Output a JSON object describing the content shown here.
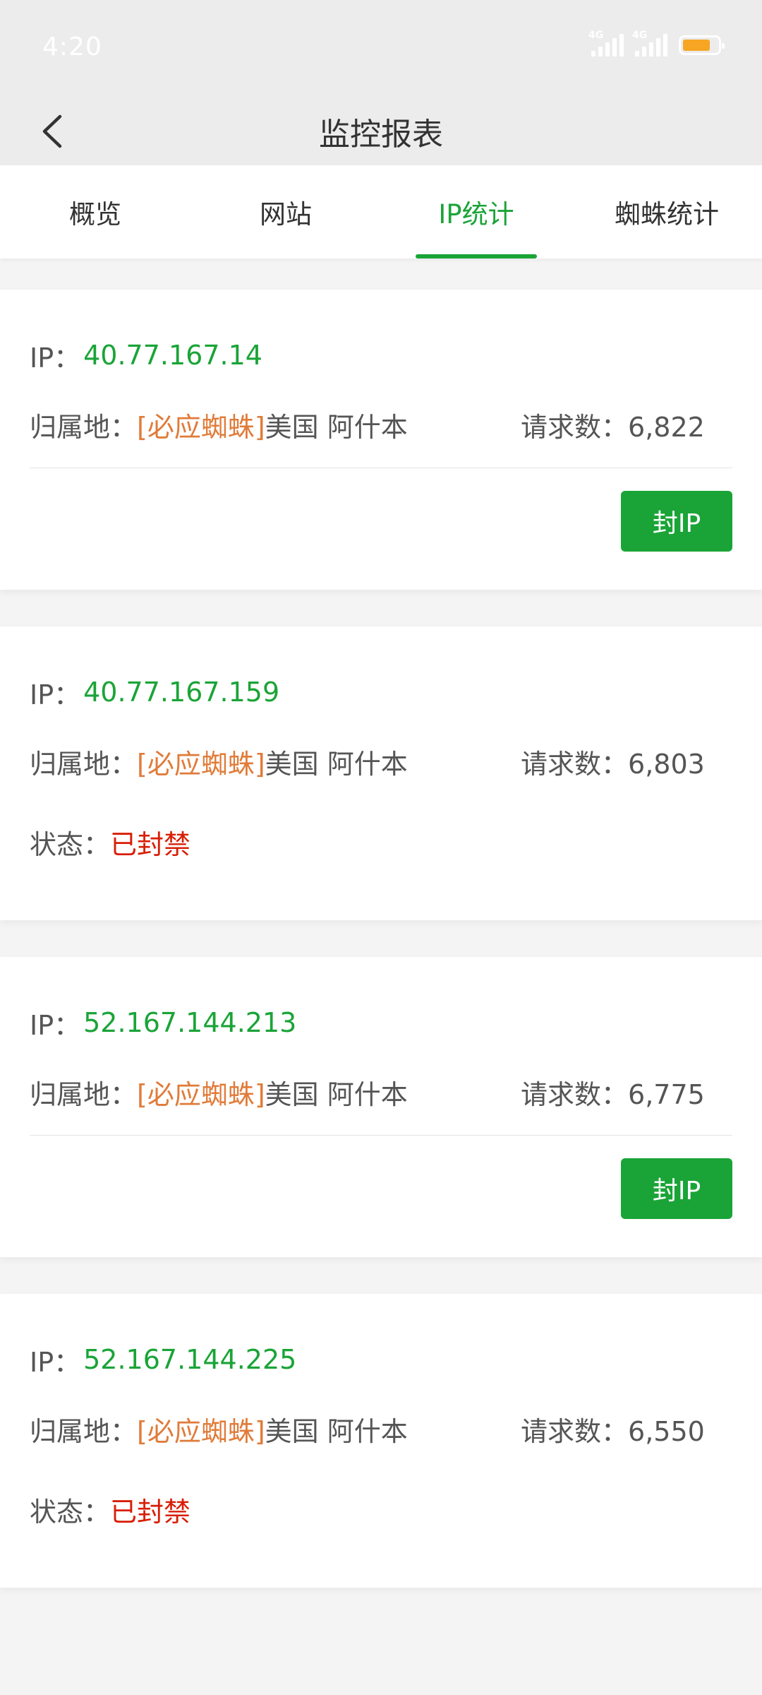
{
  "status_bar": {
    "time": "4:20",
    "network_1": "4G",
    "network_2": "4G",
    "battery_level": 0.8,
    "battery_color": "#f6a623"
  },
  "nav": {
    "title": "监控报表",
    "back_icon": "chevron-left-icon"
  },
  "tabs": [
    {
      "label": "概览",
      "active": false
    },
    {
      "label": "网站",
      "active": false
    },
    {
      "label": "IP统计",
      "active": true
    },
    {
      "label": "蜘蛛统计",
      "active": false
    }
  ],
  "labels": {
    "ip": "IP：",
    "location": "归属地：",
    "requests": "请求数：",
    "status": "状态：",
    "block_button": "封IP"
  },
  "records": [
    {
      "ip": "40.77.167.14",
      "spider": "[必应蜘蛛]",
      "place": "美国 阿什本",
      "requests": "6,822",
      "status": null,
      "can_block": true
    },
    {
      "ip": "40.77.167.159",
      "spider": "[必应蜘蛛]",
      "place": "美国 阿什本",
      "requests": "6,803",
      "status": "已封禁",
      "can_block": false
    },
    {
      "ip": "52.167.144.213",
      "spider": "[必应蜘蛛]",
      "place": "美国 阿什本",
      "requests": "6,775",
      "status": null,
      "can_block": true
    },
    {
      "ip": "52.167.144.225",
      "spider": "[必应蜘蛛]",
      "place": "美国 阿什本",
      "requests": "6,550",
      "status": "已封禁",
      "can_block": false
    }
  ],
  "colors": {
    "accent": "#1aa437",
    "spider": "#e07b39",
    "banned": "#d81e06"
  }
}
